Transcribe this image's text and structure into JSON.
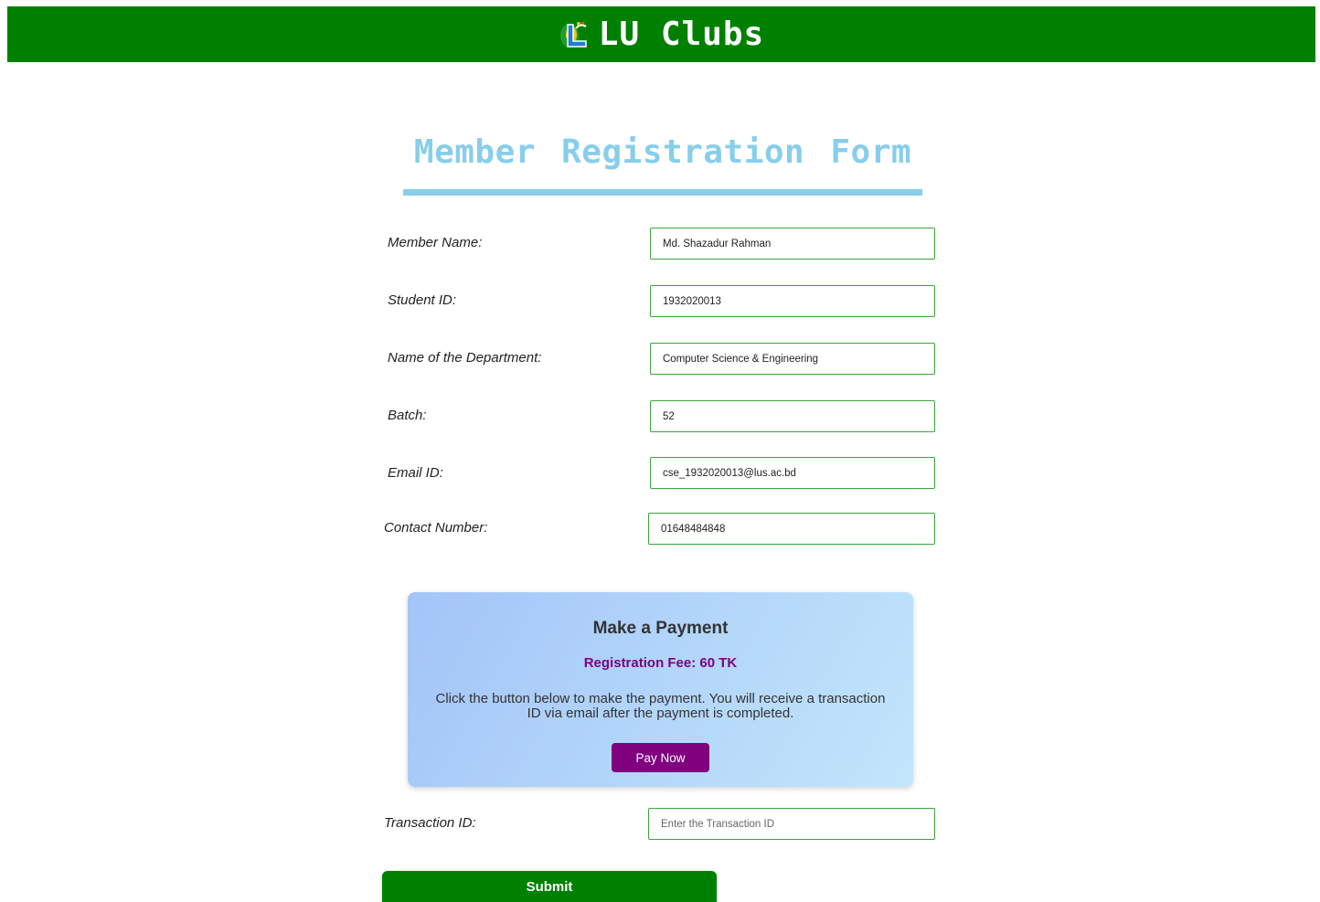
{
  "header": {
    "site_title": "LU Clubs",
    "logo_icon": "lu-logo-icon",
    "background_color": "#008000"
  },
  "form": {
    "title": "Member Registration Form",
    "title_color": "#87ceeb",
    "fields": [
      {
        "label": "Member Name:",
        "value": "Md. Shazadur Rahman",
        "placeholder": ""
      },
      {
        "label": "Student ID:",
        "value": "1932020013",
        "placeholder": ""
      },
      {
        "label": "Name of the Department:",
        "value": "Computer Science & Engineering",
        "placeholder": ""
      },
      {
        "label": "Batch:",
        "value": "52",
        "placeholder": ""
      },
      {
        "label": "Email ID:",
        "value": "cse_1932020013@lus.ac.bd",
        "placeholder": ""
      },
      {
        "label": "Contact Number:",
        "value": "01648484848",
        "placeholder": ""
      }
    ],
    "transaction": {
      "label": "Transaction ID:",
      "value": "",
      "placeholder": "Enter the Transaction ID"
    },
    "submit_label": "Submit"
  },
  "payment": {
    "title": "Make a Payment",
    "fee": "Registration Fee: 60 TK",
    "note": "Click the button below to make the payment. You will receive a transaction ID via email after the payment is completed.",
    "button_label": "Pay Now",
    "accent_color": "#800080"
  }
}
